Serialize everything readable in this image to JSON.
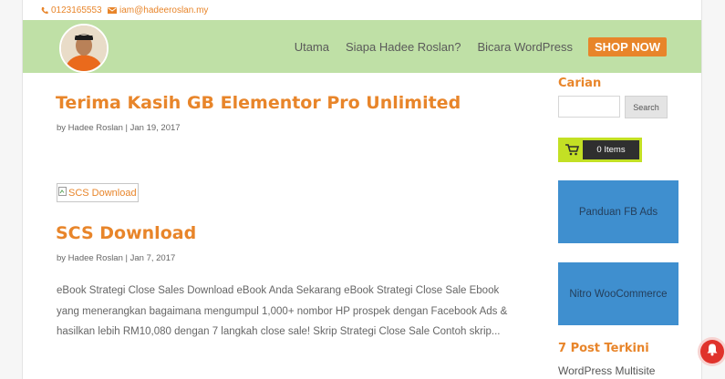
{
  "topbar": {
    "phone": "0123165553",
    "email": "iam@hadeeroslan.my"
  },
  "nav": {
    "items": [
      {
        "label": "Utama"
      },
      {
        "label": "Siapa Hadee Roslan?"
      },
      {
        "label": "Bicara WordPress"
      }
    ],
    "cta_label": "SHOP NOW"
  },
  "posts": [
    {
      "title": "Terima Kasih GB Elementor Pro Unlimited",
      "meta": "by Hadee Roslan | Jan 19, 2017"
    },
    {
      "image_alt": "SCS Download",
      "title": "SCS Download",
      "meta": "by Hadee Roslan | Jan 7, 2017",
      "excerpt": "eBook Strategi Close Sales Download eBook Anda Sekarang eBook Strategi Close Sale Ebook yang menerangkan bagaimana mengumpul 1,000+ nombor HP prospek dengan Facebook Ads & hasilkan lebih RM10,080 dengan 7 langkah close sale! Skrip Strategi Close Sale Contoh skrip..."
    }
  ],
  "sidebar": {
    "search_title": "Carian",
    "search_placeholder": "",
    "search_button": "Search",
    "cart_label": "0 Items",
    "promos": [
      {
        "label": "Panduan FB Ads"
      },
      {
        "label": "Nitro WooCommerce"
      }
    ],
    "recent_title": "7 Post Terkini",
    "recent_items": [
      "WordPress Multisite"
    ]
  },
  "colors": {
    "accent": "#e8852a",
    "header_bg": "#bfe0a6",
    "promo_bg": "#3f8fcf",
    "cart_bg": "#c3e024",
    "notification": "#e0322b"
  },
  "icons": [
    "phone-icon",
    "email-icon",
    "cart-icon",
    "broken-image-icon",
    "bell-icon"
  ]
}
